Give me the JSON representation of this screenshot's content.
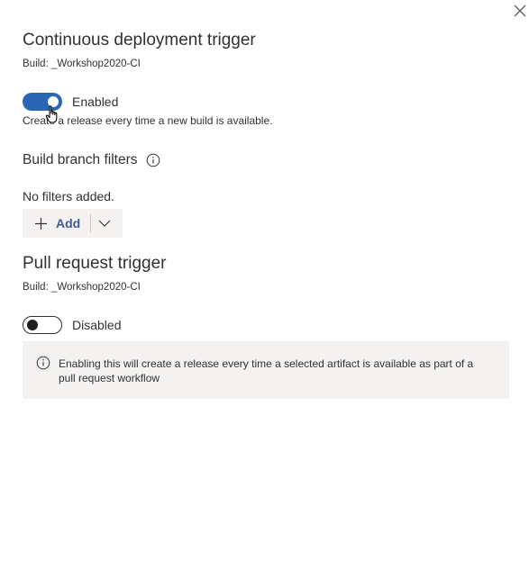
{
  "close": {
    "icon": "close-icon"
  },
  "cd_trigger": {
    "title": "Continuous deployment trigger",
    "build": "Build: _Workshop2020-CI",
    "toggle_state": "on",
    "toggle_label": "Enabled",
    "help_text": "Create a release every time a new build is available."
  },
  "branch_filters": {
    "heading": "Build branch filters",
    "info_icon": "info-icon",
    "empty_text": "No filters added.",
    "add_label": "Add",
    "add_icon": "plus-icon",
    "chevron_icon": "chevron-down-icon"
  },
  "pr_trigger": {
    "title": "Pull request trigger",
    "build": "Build: _Workshop2020-CI",
    "toggle_state": "off",
    "toggle_label": "Disabled",
    "banner_icon": "info-icon",
    "banner_text": "Enabling this will create a release every time a selected artifact is available as part of a pull request workflow"
  },
  "colors": {
    "toggle_on": "#2b66b5",
    "banner_bg": "#f3f2f1",
    "add_text": "#3d5a96"
  }
}
